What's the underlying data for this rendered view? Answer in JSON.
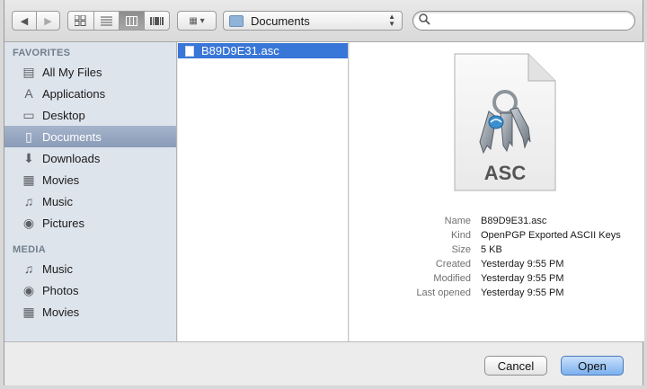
{
  "toolbar": {
    "location": "Documents",
    "search_placeholder": ""
  },
  "sidebar": {
    "favorites_header": "FAVORITES",
    "favorites": [
      {
        "label": "All My Files",
        "icon": "all-files-icon",
        "glyph": "▤"
      },
      {
        "label": "Applications",
        "icon": "applications-icon",
        "glyph": "A"
      },
      {
        "label": "Desktop",
        "icon": "desktop-icon",
        "glyph": "▭"
      },
      {
        "label": "Documents",
        "icon": "documents-icon",
        "glyph": "▯"
      },
      {
        "label": "Downloads",
        "icon": "downloads-icon",
        "glyph": "⬇"
      },
      {
        "label": "Movies",
        "icon": "movies-icon",
        "glyph": "▦"
      },
      {
        "label": "Music",
        "icon": "music-icon",
        "glyph": "♫"
      },
      {
        "label": "Pictures",
        "icon": "pictures-icon",
        "glyph": "◉"
      }
    ],
    "media_header": "MEDIA",
    "media": [
      {
        "label": "Music",
        "icon": "music-icon",
        "glyph": "♫"
      },
      {
        "label": "Photos",
        "icon": "photos-icon",
        "glyph": "◉"
      },
      {
        "label": "Movies",
        "icon": "movies-icon",
        "glyph": "▦"
      }
    ],
    "selected": "Documents"
  },
  "files": [
    {
      "name": "B89D9E31.asc",
      "selected": true
    }
  ],
  "preview": {
    "icon_label": "ASC",
    "info": [
      {
        "label": "Name",
        "value": "B89D9E31.asc"
      },
      {
        "label": "Kind",
        "value": "OpenPGP Exported ASCII Keys"
      },
      {
        "label": "Size",
        "value": "5 KB"
      },
      {
        "label": "Created",
        "value": "Yesterday 9:55 PM"
      },
      {
        "label": "Modified",
        "value": "Yesterday 9:55 PM"
      },
      {
        "label": "Last opened",
        "value": "Yesterday 9:55 PM"
      }
    ]
  },
  "buttons": {
    "cancel": "Cancel",
    "open": "Open"
  },
  "colors": {
    "selection": "#3876d7",
    "sidebar_bg": "#dee4ec",
    "primary_button": "#7ab0ef"
  }
}
